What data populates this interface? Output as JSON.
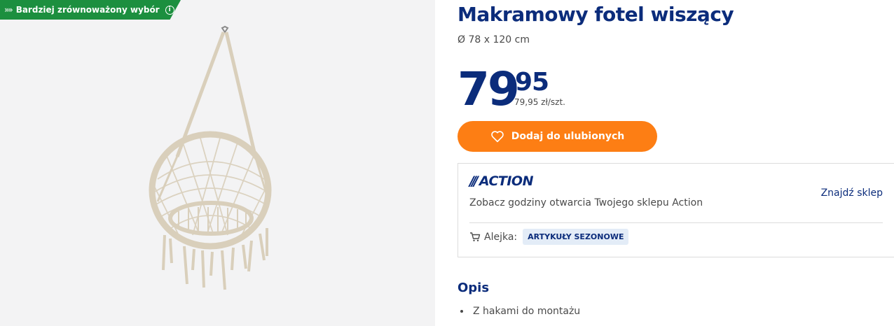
{
  "badge": {
    "label": "Bardziej zrównoważony wybór",
    "arrows": "»»",
    "info": "i"
  },
  "product": {
    "title": "Makramowy fotel wiszący",
    "size": "Ø 78 x 120 cm",
    "price_int": "79",
    "price_dec": "95",
    "unit_price": "79,95 zł/szt."
  },
  "actions": {
    "favorite_label": "Dodaj do ulubionych"
  },
  "store": {
    "logo_text": "ACTION",
    "logo_slashes": "///",
    "find_store": "Znajdź sklep",
    "hours_text": "Zobacz godziny otwarcia Twojego sklepu Action",
    "aisle_label": "Alejka:",
    "aisle_value": "ARTYKUŁY SEZONOWE"
  },
  "description": {
    "title": "Opis",
    "items": [
      "Z hakami do montażu"
    ]
  },
  "colors": {
    "brand": "#0b2c7b",
    "accent": "#fd7e14",
    "badge": "#1c8f3f"
  }
}
